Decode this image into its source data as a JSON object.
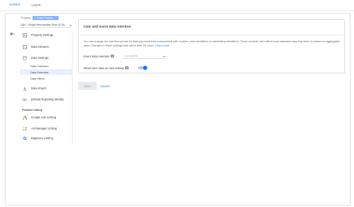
{
  "tabs": [
    {
      "label": "ADMIN",
      "active": true
    },
    {
      "label": "USER",
      "active": false
    }
  ],
  "property": {
    "label": "Property",
    "chip": "+ Create Property",
    "selected": "GA4 - Google Merchandise Store (2718..."
  },
  "sidebar": {
    "items": [
      {
        "label": "Property Settings",
        "icon": "property-settings-icon"
      },
      {
        "label": "Data Streams",
        "icon": "data-streams-icon"
      },
      {
        "label": "Data Settings",
        "icon": "data-settings-icon"
      },
      {
        "label": "Data Import",
        "icon": "data-import-icon"
      },
      {
        "label": "Default Reporting Identity",
        "icon": "reporting-identity-icon"
      }
    ],
    "sub_items": [
      {
        "label": "Data Collection",
        "active": false
      },
      {
        "label": "Data Retention",
        "active": true
      },
      {
        "label": "Data Filters",
        "active": false
      }
    ],
    "product_linking_title": "Product Linking",
    "links": [
      {
        "label": "Google Ads Linking",
        "icon": "google-ads-icon"
      },
      {
        "label": "Ad Manager Linking",
        "icon": "ad-manager-icon"
      },
      {
        "label": "BigQuery Linking",
        "icon": "bigquery-icon"
      }
    ]
  },
  "card": {
    "title": "User and event data retention",
    "description": "You can change the retention period for data you send that is associated with cookies, user-identifiers, or advertising identifiers. These controls don't affect most standard reporting which is based on aggregated data. Changes to these settings take effect after 24 hours.",
    "learn_more": "Learn more",
    "retention_label": "Event data retention",
    "retention_value": "14 months",
    "reset_label": "Reset user data on new activity",
    "reset_on": true
  },
  "actions": {
    "save": "Save",
    "cancel": "Cancel"
  },
  "colors": {
    "accent": "#1a73e8",
    "toggle_track": "#a8c7fa"
  }
}
